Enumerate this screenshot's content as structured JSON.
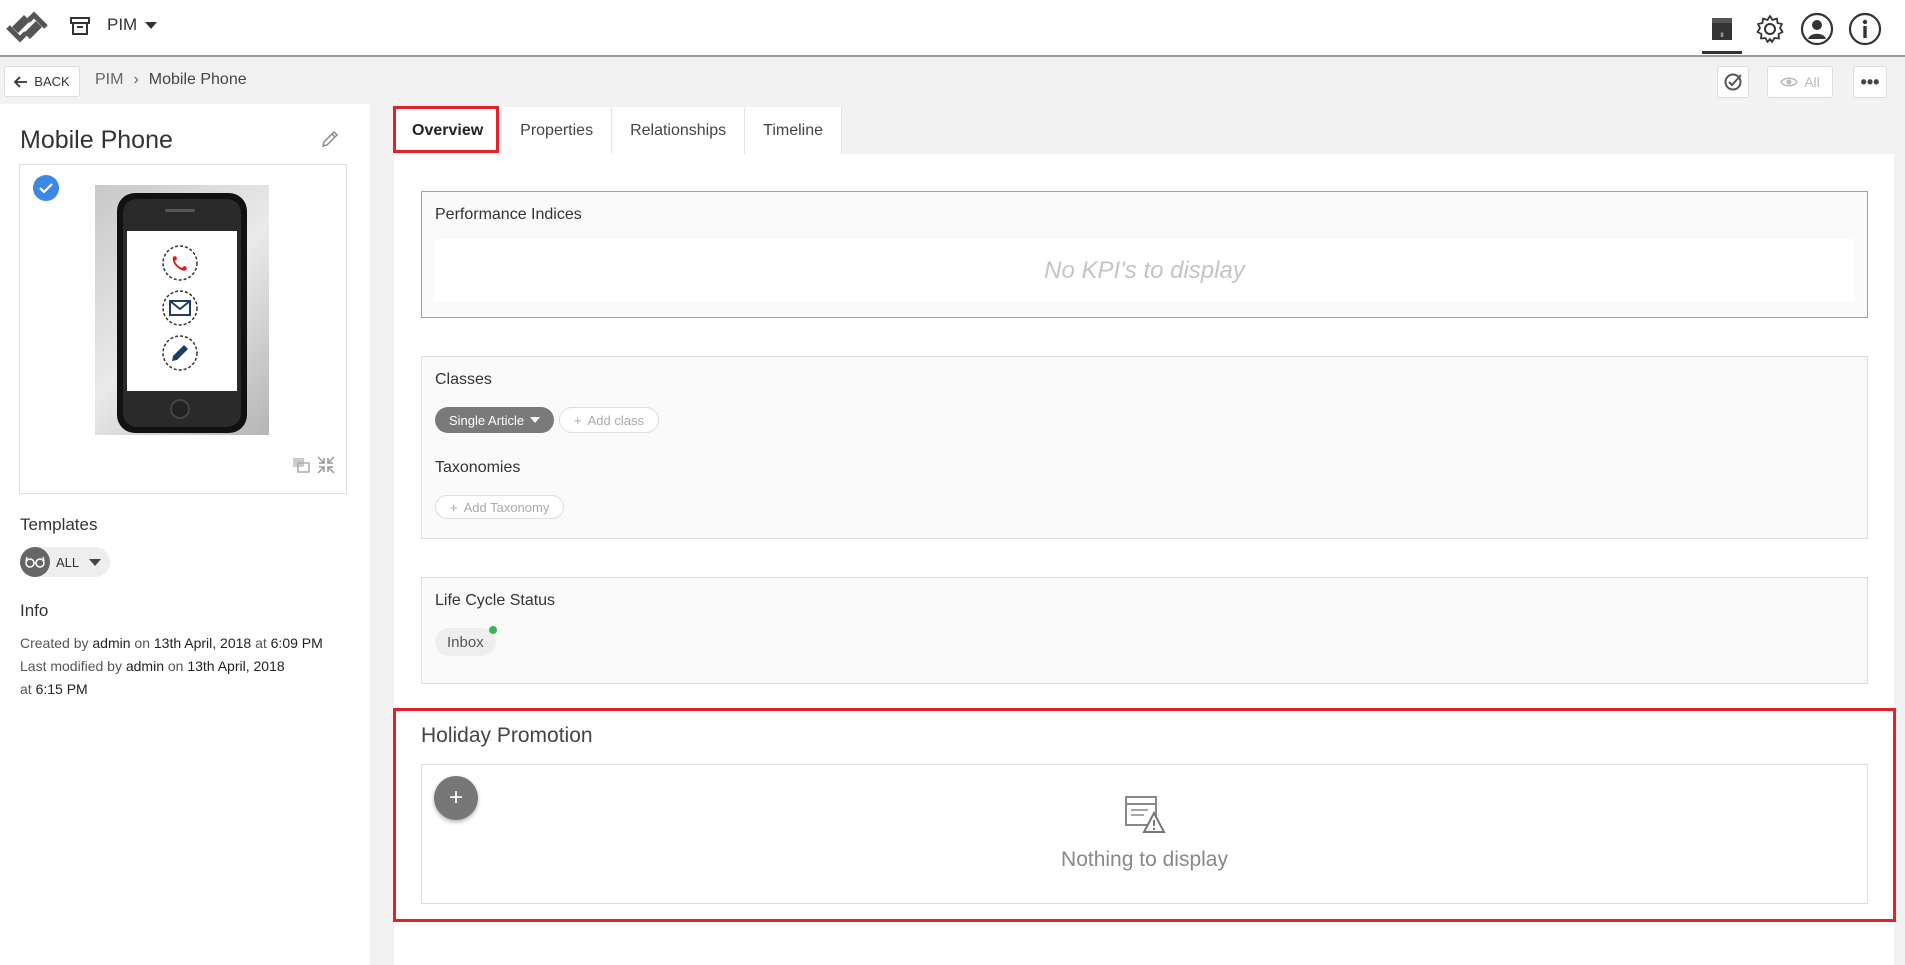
{
  "header": {
    "app_name": "PIM",
    "icons": [
      "app-logo-icon",
      "archive-icon",
      "catalog-icon",
      "gear-icon",
      "user-icon",
      "info-icon"
    ]
  },
  "subbar": {
    "back_label": "BACK",
    "breadcrumb": [
      "PIM",
      "Mobile Phone"
    ],
    "breadcrumb_separator": "›",
    "view_all_label": "All"
  },
  "object": {
    "title": "Mobile Phone",
    "templates_heading": "Templates",
    "templates_value": "ALL",
    "info_heading": "Info",
    "created_prefix": "Created by",
    "created_user": "admin",
    "created_on": "on",
    "created_date": "13th April, 2018",
    "created_at": "at",
    "created_time": "6:09 PM",
    "modified_prefix": "Last modified by",
    "modified_user": "admin",
    "modified_on": "on",
    "modified_date_a": "13th April,",
    "modified_date_b": "2018",
    "modified_at": "at",
    "modified_time": "6:15 PM"
  },
  "tabs": [
    {
      "label": "Overview",
      "active": true
    },
    {
      "label": "Properties",
      "active": false
    },
    {
      "label": "Relationships",
      "active": false
    },
    {
      "label": "Timeline",
      "active": false
    }
  ],
  "overview": {
    "kpi_title": "Performance Indices",
    "kpi_empty": "No KPI's to display",
    "classes_title": "Classes",
    "class_chip": "Single Article",
    "add_class": "Add class",
    "taxonomies_title": "Taxonomies",
    "add_taxonomy": "Add Taxonomy",
    "lifecycle_title": "Life Cycle Status",
    "lifecycle_value": "Inbox",
    "lifecycle_dot_color": "#3bb54a",
    "promo_title": "Holiday Promotion",
    "promo_add_symbol": "+",
    "promo_empty": "Nothing to display"
  },
  "colors": {
    "highlight_red": "#e3202b",
    "check_blue": "#3d87e6"
  }
}
